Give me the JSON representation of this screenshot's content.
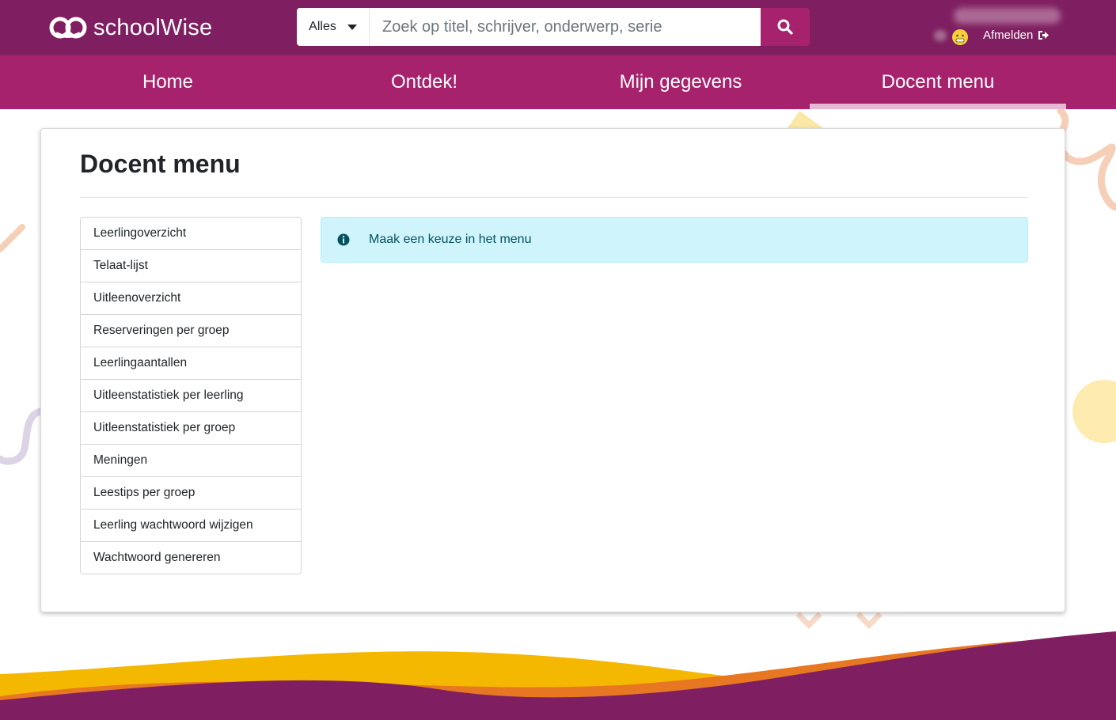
{
  "brand": {
    "name": "schoolWise"
  },
  "search": {
    "scope": "Alles",
    "placeholder": "Zoek op titel, schrijver, onderwerp, serie",
    "icon": "search-icon"
  },
  "user": {
    "logout_label": "Afmelden",
    "avatar_icon": "emoji-avatar-icon",
    "logout_icon": "sign-out-icon"
  },
  "nav": {
    "items": [
      {
        "label": "Home"
      },
      {
        "label": "Ontdek!"
      },
      {
        "label": "Mijn gegevens"
      },
      {
        "label": "Docent menu",
        "active": true
      }
    ]
  },
  "page": {
    "title": "Docent menu",
    "menu": [
      {
        "label": "Leerlingoverzicht"
      },
      {
        "label": "Telaat-lijst"
      },
      {
        "label": "Uitleenoverzicht"
      },
      {
        "label": "Reserveringen per groep"
      },
      {
        "label": "Leerlingaantallen"
      },
      {
        "label": "Uitleenstatistiek per leerling"
      },
      {
        "label": "Uitleenstatistiek per groep"
      },
      {
        "label": "Meningen"
      },
      {
        "label": "Leestips per groep"
      },
      {
        "label": "Leerling wachtwoord wijzigen"
      },
      {
        "label": "Wachtwoord genereren"
      }
    ],
    "alert": {
      "icon": "info-icon",
      "text": "Maak een keuze in het menu"
    }
  },
  "colors": {
    "topbar": "#7f1f61",
    "nav": "#a6226c",
    "alert_bg": "#cff4fc",
    "wave_yellow": "#f5b800",
    "wave_orange": "#e87722",
    "wave_purple": "#7f1f61"
  }
}
